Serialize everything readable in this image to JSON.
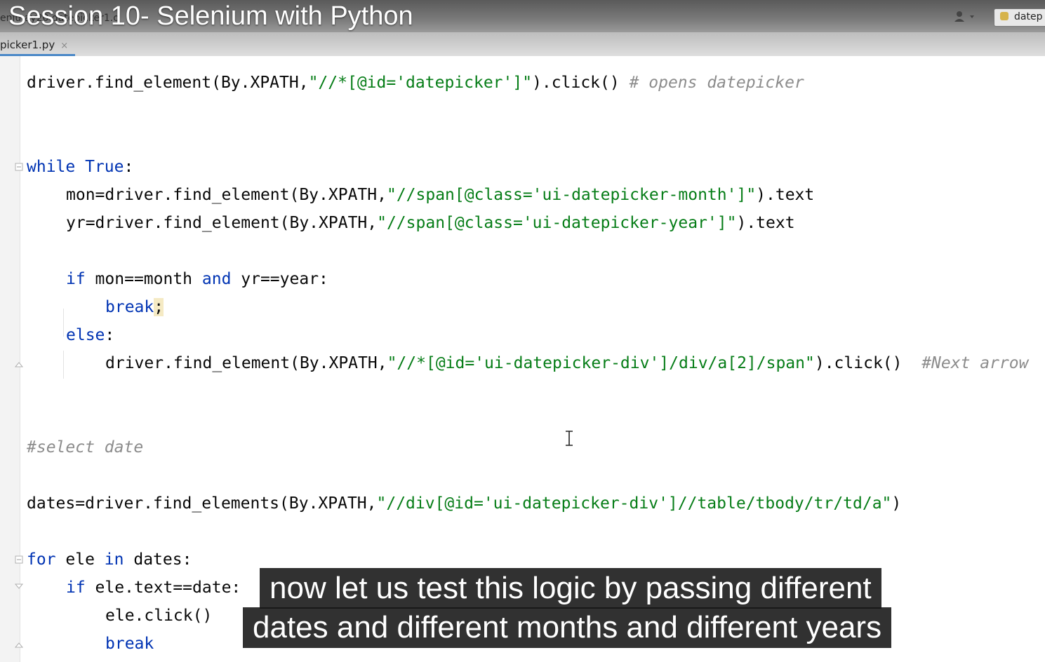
{
  "titlebar": {
    "crumbs": "eniu     ay20    datepicker1.o",
    "video_title": "Session 10- Selenium with Python",
    "run_config": "datep"
  },
  "tab": {
    "filename": "picker1.py",
    "close": "×"
  },
  "code": {
    "l1_a": "driver.find_element(By.XPATH,",
    "l1_s": "\"//*[@id='datepicker']\"",
    "l1_b": ").click() ",
    "l1_c": "# opens datepicker",
    "l2_kw1": "while",
    "l2_kw2": "True",
    "l2_b": ":",
    "l3_a": "mon=driver.find_element(By.XPATH,",
    "l3_s": "\"//span[@class='ui-datepicker-month']\"",
    "l3_b": ").text",
    "l4_a": "yr=driver.find_element(By.XPATH,",
    "l4_s": "\"//span[@class='ui-datepicker-year']\"",
    "l4_b": ").text",
    "l5_kw1": "if",
    "l5_a": " mon==month ",
    "l5_kw2": "and",
    "l5_b": " yr==year:",
    "l6_kw": "break",
    "l6_b": ";",
    "l7_kw": "else",
    "l7_b": ":",
    "l8_a": "driver.find_element(By.XPATH,",
    "l8_s": "\"//*[@id='ui-datepicker-div']/div/a[2]/span\"",
    "l8_b": ").click()  ",
    "l8_c": "#Next arrow",
    "l9_c": "#select date",
    "l10_a": "dates=driver.find_elements(By.XPATH,",
    "l10_s": "\"//div[@id='ui-datepicker-div']//table/tbody/tr/td/a\"",
    "l10_b": ")",
    "l11_kw1": "for",
    "l11_a": " ele ",
    "l11_kw2": "in",
    "l11_b": " dates:",
    "l12_kw": "if",
    "l12_a": " ele.text==date:",
    "l13_a": "ele.click()",
    "l14_kw": "break"
  },
  "captions": {
    "line1": "now let us test this logic by passing different",
    "line2": "dates and different months and different years"
  },
  "icons": {
    "user": "user-icon",
    "python": "python-file-icon",
    "text_cursor": "text-cursor-icon"
  },
  "colors": {
    "keyword": "#0033b3",
    "string": "#067d17",
    "comment": "#8c8c8c"
  }
}
